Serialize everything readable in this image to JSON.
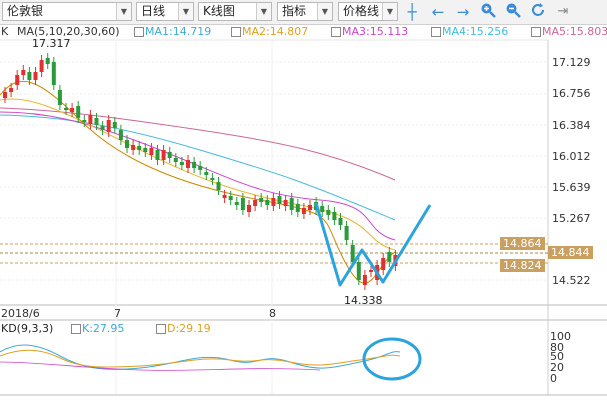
{
  "toolbar": {
    "symbol": "伦敦银",
    "period": "日线",
    "chart_type": "K线图",
    "indicator": "指标",
    "price_line": "价格线",
    "icons": [
      "crosshair-icon",
      "arrow-left-icon",
      "arrow-right-icon",
      "zoom-in-icon",
      "zoom-out-icon",
      "refresh-icon",
      "scroll-right-icon"
    ]
  },
  "legend": {
    "k_label": "K",
    "ma_label": "MA(5,10,20,30,60)",
    "ma1": "MA1:14.719",
    "ma2": "MA2:14.807",
    "ma3": "MA3:15.113",
    "ma4": "MA4:15.256",
    "ma5": "MA5:15.803"
  },
  "kd_legend": {
    "label": "KD(9,3,3)",
    "k": "K:27.95",
    "d": "D:29.19"
  },
  "price_axis": [
    "17.129",
    "16.756",
    "16.384",
    "16.012",
    "15.639",
    "15.267",
    "14.522"
  ],
  "kd_axis": [
    "100",
    "80",
    "50",
    "20",
    "0"
  ],
  "high_label": "17.317",
  "low_label": "14.338",
  "price_tags": {
    "upper": "14.864",
    "lower": "14.824",
    "current": "14.844"
  },
  "x_labels": [
    "2018/6",
    "7",
    "8"
  ],
  "colors": {
    "up": "#e03030",
    "down": "#2a9a3a",
    "ma1": "#cc8800",
    "ma2": "#e8b830",
    "ma3": "#cc44cc",
    "ma4": "#44bbdd",
    "ma5": "#cc6699",
    "annotation": "#2ba3dc",
    "tag": "#c9a060"
  }
}
